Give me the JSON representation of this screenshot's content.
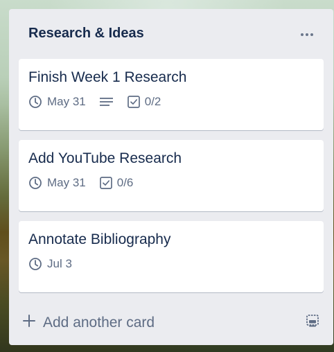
{
  "list": {
    "title": "Research & Ideas",
    "menu_icon": "more-horizontal-icon"
  },
  "cards": [
    {
      "title": "Finish Week 1 Research",
      "due": "May 31",
      "has_description": true,
      "checklist": "0/2"
    },
    {
      "title": "Add YouTube Research",
      "due": "May 31",
      "has_description": false,
      "checklist": "0/6"
    },
    {
      "title": "Annotate Bibliography",
      "due": "Jul 3",
      "has_description": false,
      "checklist": null
    }
  ],
  "footer": {
    "add_label": "Add another card",
    "add_icon": "plus-icon",
    "template_icon": "card-template-icon"
  },
  "colors": {
    "list_bg": "#ebecf0",
    "title": "#172b4d",
    "muted": "#5e6c84"
  }
}
